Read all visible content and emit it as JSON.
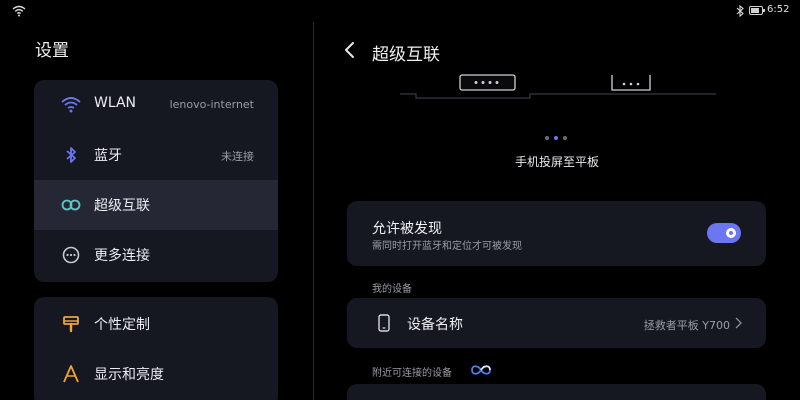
{
  "status_bar": {
    "time": "6:52",
    "battery_level": 0.8,
    "icons": [
      "wifi-icon",
      "bluetooth-icon",
      "battery-icon"
    ]
  },
  "left": {
    "title": "设置",
    "group1": [
      {
        "label": "WLAN",
        "value": "lenovo-internet",
        "icon": "wifi-icon"
      },
      {
        "label": "蓝牙",
        "value": "未连接",
        "icon": "bluetooth-icon"
      },
      {
        "label": "超级互联",
        "value": "",
        "icon": "infinity-icon",
        "active": true
      },
      {
        "label": "更多连接",
        "value": "",
        "icon": "more-dots-icon"
      }
    ],
    "group2": [
      {
        "label": "个性定制",
        "icon": "brush-icon"
      },
      {
        "label": "显示和亮度",
        "icon": "display-a-icon"
      }
    ]
  },
  "right": {
    "title": "超级互联",
    "carousel": {
      "caption": "手机投屏至平板",
      "pages": 3,
      "active_page": 1
    },
    "discover": {
      "title": "允许被发现",
      "subtitle": "需同时打开蓝牙和定位才可被发现",
      "enabled": true
    },
    "my_devices": {
      "section_label": "我的设备",
      "label": "设备名称",
      "value": "拯救者平板 Y700"
    },
    "nearby": {
      "section_label": "附近可连接的设备"
    }
  },
  "colors": {
    "accent": "#6b76f0",
    "card": "#151721",
    "active_row": "#252834",
    "background": "#000000"
  }
}
